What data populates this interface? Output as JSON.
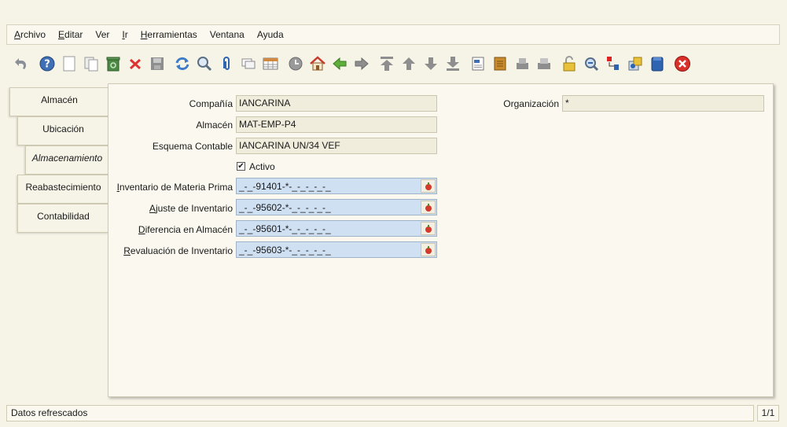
{
  "menu": {
    "archivo": {
      "first": "A",
      "rest": "rchivo"
    },
    "editar": {
      "first": "E",
      "rest": "ditar"
    },
    "ver": "Ver",
    "ir": {
      "first": "I",
      "rest": "r"
    },
    "herramientas": {
      "first": "H",
      "rest": "erramientas"
    },
    "ventana": "Ventana",
    "ayuda": "Ayuda"
  },
  "toolbar_icons": [
    "undo-icon",
    "help-icon",
    "new-icon",
    "copy-icon",
    "recycle-icon",
    "delete-icon",
    "save-icon",
    "refresh-icon",
    "find-icon",
    "attachment-icon",
    "chat-icon",
    "grid-toggle-icon",
    "history-icon",
    "home-icon",
    "back-icon",
    "forward-icon",
    "first-record-icon",
    "previous-record-icon",
    "next-record-icon",
    "last-record-icon",
    "report-icon",
    "archive-icon",
    "print-preview-icon",
    "print-icon",
    "lock-icon",
    "zoom-across-icon",
    "workflow-icon",
    "product-info-icon",
    "active-workflows-icon",
    "close-window-icon"
  ],
  "tabs": [
    {
      "label": "Almacén"
    },
    {
      "label": "Ubicación"
    },
    {
      "label": "Almacenamiento"
    },
    {
      "label": "Reabastecimiento"
    },
    {
      "label": "Contabilidad"
    }
  ],
  "form": {
    "compania_label": "Compañía",
    "compania_value": "IANCARINA",
    "organizacion_label": "Organización",
    "organizacion_value": "*",
    "almacen_label": "Almacén",
    "almacen_value": "MAT-EMP-P4",
    "esquema_label": "Esquema Contable",
    "esquema_value": "IANCARINA UN/34 VEF",
    "activo_label": "Activo",
    "activo_checked": "✔",
    "inv_mp": {
      "first": "I",
      "rest": "nventario de Materia Prima",
      "value": "_-_-91401-*-_-_-_-_-_"
    },
    "ajuste": {
      "first": "A",
      "rest": "juste de Inventario",
      "value": "_-_-95602-*-_-_-_-_-_"
    },
    "diferencia": {
      "first": "D",
      "rest": "iferencia en Almacén",
      "value": "_-_-95601-*-_-_-_-_-_"
    },
    "revaluacion": {
      "first": "R",
      "rest": "evaluación de Inventario",
      "value": "_-_-95603-*-_-_-_-_-_"
    }
  },
  "status": {
    "message": "Datos refrescados",
    "pager": "1/1"
  }
}
